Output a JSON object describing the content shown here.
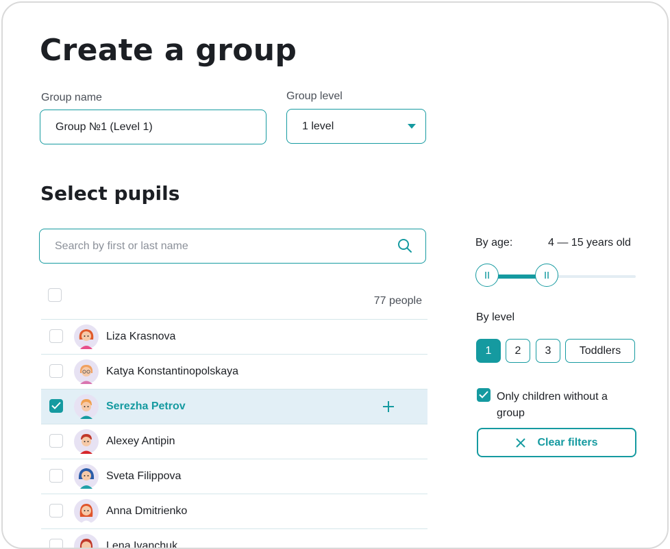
{
  "page": {
    "title": "Create a group"
  },
  "form": {
    "group_name_label": "Group name",
    "group_name_value": "Group №1 (Level 1)",
    "group_level_label": "Group level",
    "group_level_value": "1 level"
  },
  "pupils": {
    "section_title": "Select pupils",
    "search_placeholder": "Search by first or last name",
    "count_text": "77 people",
    "rows": [
      {
        "name": "Liza Krasnova",
        "checked": false
      },
      {
        "name": "Katya Konstantinopolskaya",
        "checked": false
      },
      {
        "name": "Serezha Petrov",
        "checked": true
      },
      {
        "name": "Alexey Antipin",
        "checked": false
      },
      {
        "name": "Sveta Filippova",
        "checked": false
      },
      {
        "name": "Anna Dmitrienko",
        "checked": false
      },
      {
        "name": "Lena Ivanchuk",
        "checked": false
      }
    ]
  },
  "filters": {
    "age_label": "By age:",
    "age_range_text": "4 — 15 years old",
    "age_min": 4,
    "age_max": 15,
    "level_label": "By level",
    "levels": [
      "1",
      "2",
      "3",
      "Toddlers"
    ],
    "active_level": "1",
    "only_without_group_label": "Only children without a group",
    "only_without_group_checked": true,
    "clear_label": "Clear filters"
  },
  "colors": {
    "accent": "#159aa0",
    "selected_row_bg": "#e2eff6",
    "border": "#d4e6ea"
  },
  "icons": {
    "search": "search-icon",
    "dropdown": "chevron-down-icon",
    "add": "plus-icon",
    "clear": "close-icon",
    "check": "check-icon"
  }
}
